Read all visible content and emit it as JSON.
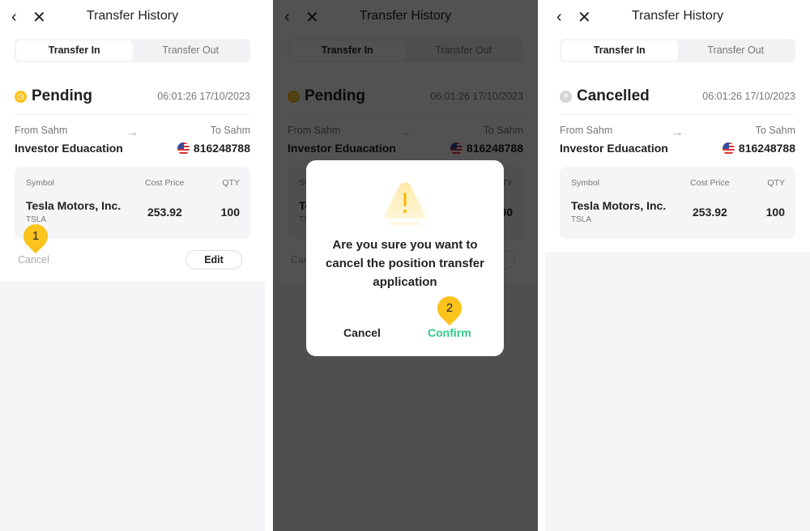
{
  "header": {
    "title": "Transfer History",
    "back_icon": "chevron-left-icon",
    "close_icon": "close-icon"
  },
  "tabs": [
    "Transfer In",
    "Transfer Out"
  ],
  "transfer": {
    "time": "06:01:26 17/10/2023",
    "from_label": "From Sahm",
    "from_value": "Investor Eduacation",
    "to_label": "To Sahm",
    "to_value": "816248788",
    "columns": [
      "Symbol",
      "Cost Price",
      "QTY"
    ],
    "stock_name": "Tesla Motors, Inc.",
    "ticker": "TSLA",
    "cost_price": "253.92",
    "qty": "100"
  },
  "panels": [
    {
      "status": "Pending",
      "status_color": "#fbc31b",
      "status_icon": "clock-icon",
      "cancel_label": "Cancel",
      "edit_label": "Edit",
      "step": "1"
    },
    {
      "status": "Pending",
      "status_color": "#fbc31b",
      "status_icon": "clock-icon",
      "cancel_label": "Cancel",
      "edit_label": "Edit"
    },
    {
      "status": "Cancelled",
      "status_color": "#d4d4d4",
      "status_icon": "x-circle-icon"
    }
  ],
  "dialog": {
    "message": "Are you sure you want to cancel the position transfer application",
    "cancel_label": "Cancel",
    "confirm_label": "Confirm",
    "confirm_color": "#2ecc87",
    "step": "2",
    "icon": "warning-icon"
  }
}
